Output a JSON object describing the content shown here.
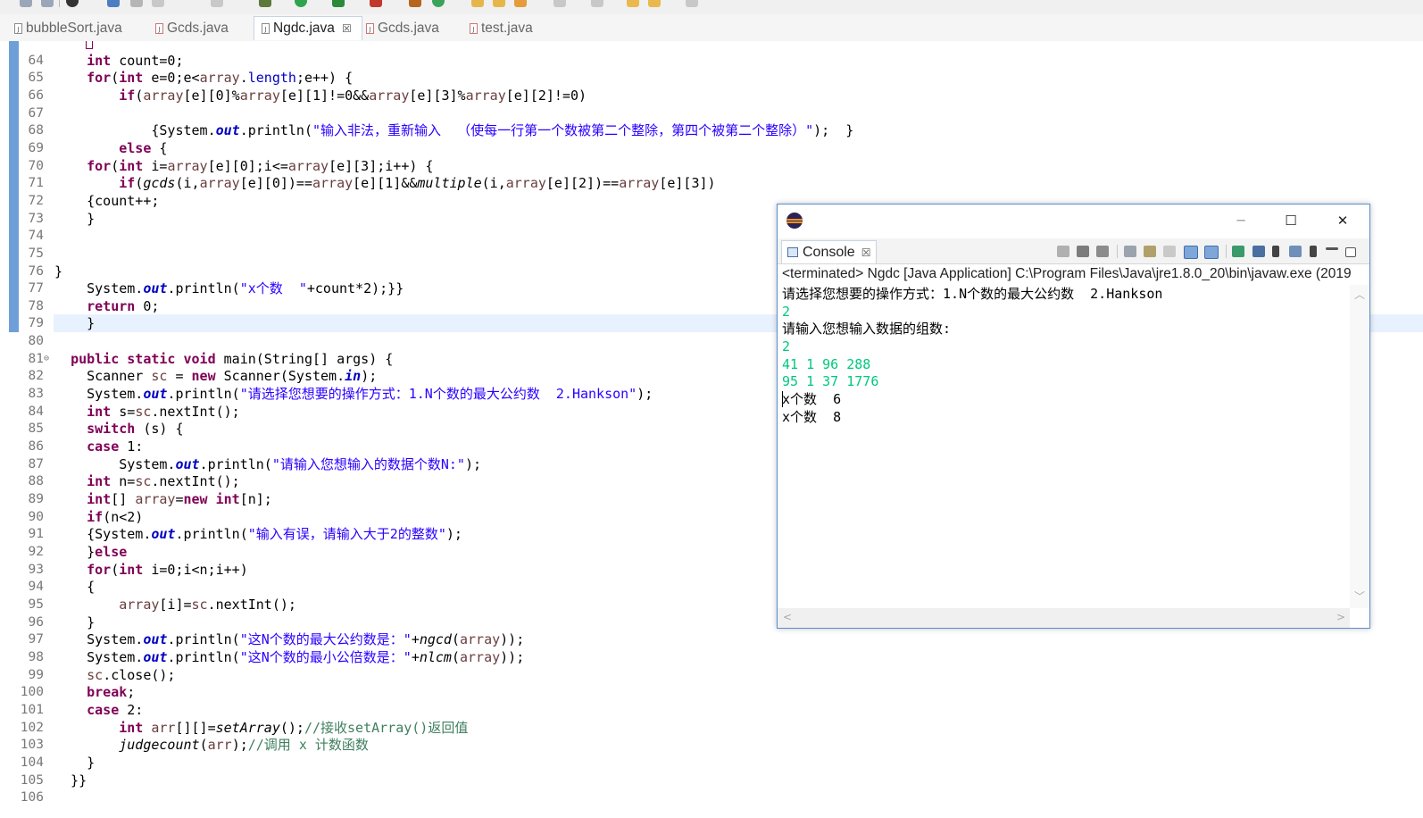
{
  "tabs": [
    {
      "label": "bubbleSort.java"
    },
    {
      "label": "Gcds.java"
    },
    {
      "label": "Ngdc.java",
      "close": "☒"
    },
    {
      "label": "Gcds.java"
    },
    {
      "label": "test.java"
    }
  ],
  "editor": {
    "line_numbers": [
      "64",
      "65",
      "66",
      "67",
      "68",
      "69",
      "70",
      "71",
      "72",
      "73",
      "74",
      "75",
      "76",
      "77",
      "78",
      "79",
      "80",
      "81",
      "82",
      "83",
      "84",
      "85",
      "86",
      "87",
      "88",
      "89",
      "90",
      "91",
      "92",
      "93",
      "94",
      "95",
      "96",
      "97",
      "98",
      "99",
      "100",
      "101",
      "102",
      "103",
      "104",
      "105",
      "106"
    ],
    "strings": {
      "l68": "\"输入非法，重新输入  （使每一行第一个数被第二个整除，第四个被第二个整除）\"",
      "l77": "\"x个数  \"",
      "l83": "\"请选择您想要的操作方式：1.N个数的最大公约数  2.Hankson\"",
      "l87": "\"请输入您想输入的数据个数N:\"",
      "l91": "\"输入有误，请输入大于2的整数\"",
      "l97": "\"这N个数的最大公约数是：\"",
      "l98": "\"这N个数的最小公倍数是：\"",
      "l102_comment": "//接收setArray()返回值",
      "l103_comment": "//调用 x 计数函数"
    }
  },
  "console": {
    "tab_label": "Console",
    "tab_close": "☒",
    "status": "<terminated> Ngdc [Java Application] C:\\Program Files\\Java\\jre1.8.0_20\\bin\\javaw.exe (2019",
    "output": [
      {
        "text": "请选择您想要的操作方式：1.N个数的最大公约数  2.Hankson",
        "input": false
      },
      {
        "text": "2",
        "input": true
      },
      {
        "text": "请输入您想输入数据的组数:",
        "input": false
      },
      {
        "text": "2",
        "input": true
      },
      {
        "text": "41 1 96 288",
        "input": true
      },
      {
        "text": "95 1 37 1776",
        "input": true
      },
      {
        "text": "x个数  6",
        "input": false
      },
      {
        "text": "x个数  8",
        "input": false
      }
    ],
    "colors": {
      "input_text": "#00c87d",
      "frame": "#5a8fd0"
    }
  },
  "icons": [
    "file-icon",
    "eclipse-icon",
    "console-icon",
    "minimize-icon",
    "maximize-icon",
    "close-icon",
    "terminate-icon",
    "remove-launch-icon",
    "scroll-lock-icon",
    "pin-icon",
    "open-console-icon"
  ]
}
